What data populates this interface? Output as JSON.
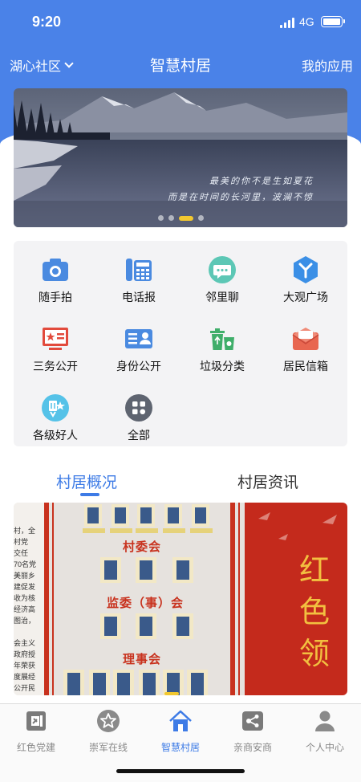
{
  "status_bar": {
    "time": "9:20",
    "network": "4G"
  },
  "nav": {
    "community": "湖心社区",
    "title": "智慧村居",
    "right_link": "我的应用"
  },
  "banner": {
    "caption_line1": "最美的你不是生如夏花",
    "caption_line2": "而是在时间的长河里，波澜不惊",
    "page_count": 4,
    "active_page": 3
  },
  "grid": {
    "items": [
      {
        "label": "随手拍",
        "icon": "camera-icon",
        "color": "#4a8ae0"
      },
      {
        "label": "电话报",
        "icon": "phone-icon",
        "color": "#4a8ae0"
      },
      {
        "label": "邻里聊",
        "icon": "chat-icon",
        "color": "#5cc7b5"
      },
      {
        "label": "大观广场",
        "icon": "plaza-icon",
        "color": "#3b8fe6"
      },
      {
        "label": "三务公开",
        "icon": "monitor-icon",
        "color": "#e24a3c"
      },
      {
        "label": "身份公开",
        "icon": "id-card-icon",
        "color": "#4a8ae0"
      },
      {
        "label": "垃圾分类",
        "icon": "trash-sort-icon",
        "color": "#3fae6a"
      },
      {
        "label": "居民信箱",
        "icon": "mailbox-icon",
        "color": "#e86650"
      },
      {
        "label": "各级好人",
        "icon": "good-person-icon",
        "color": "#55c2e8"
      },
      {
        "label": "全部",
        "icon": "all-apps-icon",
        "color": "#5e6470"
      }
    ]
  },
  "tabs": {
    "items": [
      {
        "label": "村居概况",
        "active": true
      },
      {
        "label": "村居资讯",
        "active": false
      }
    ]
  },
  "content_photo": {
    "board_title_1": "村委会",
    "board_title_2": "监委（事）会",
    "board_title_3": "理事会",
    "side_text": "红色领",
    "left_text_lines": [
      "村，全",
      "村党",
      "交任",
      "70名党",
      "美丽乡",
      "建促发",
      "收为核",
      "经济高",
      "图治，",
      "会主义",
      "政府授",
      "年荣获",
      "度展经",
      "公开民"
    ]
  },
  "tabbar": {
    "items": [
      {
        "label": "红色党建",
        "icon": "party-building-icon",
        "active": false
      },
      {
        "label": "崇军在线",
        "icon": "star-icon",
        "active": false
      },
      {
        "label": "智慧村居",
        "icon": "home-icon",
        "active": true
      },
      {
        "label": "亲商安商",
        "icon": "business-icon",
        "active": false
      },
      {
        "label": "个人中心",
        "icon": "person-icon",
        "active": false
      }
    ]
  },
  "colors": {
    "primary": "#4a82e8",
    "accent": "#3d7be6",
    "indicator": "#f2c82f"
  }
}
